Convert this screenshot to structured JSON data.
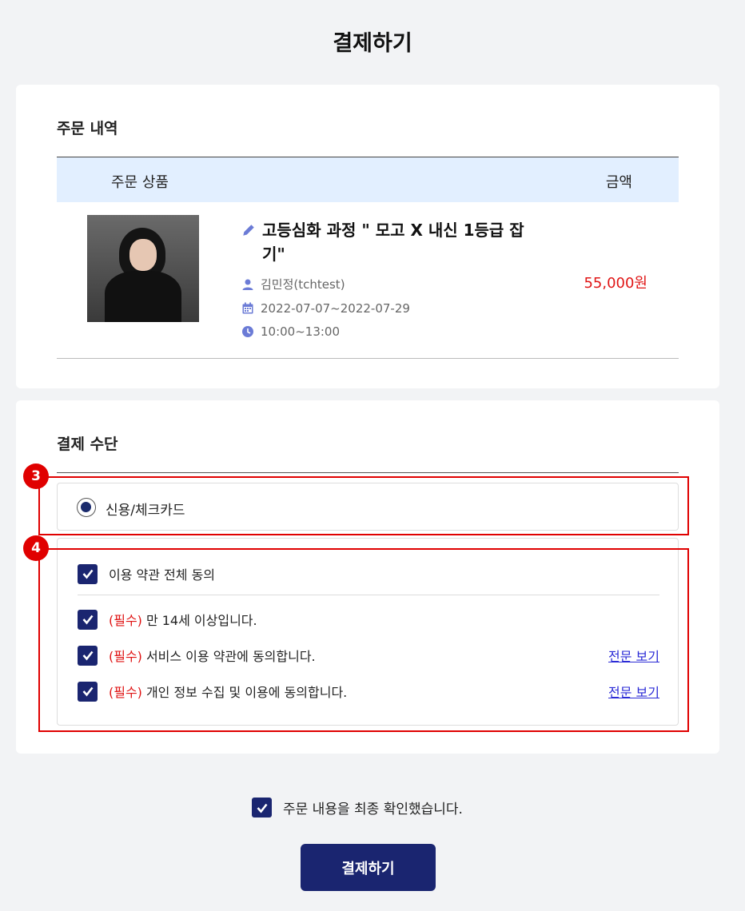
{
  "page": {
    "title": "결제하기"
  },
  "order": {
    "section_title": "주문 내역",
    "columns": {
      "product": "주문 상품",
      "price": "금액"
    },
    "item": {
      "name": "고등심화 과정 \" 모고 X 내신 1등급 잡기\"",
      "teacher": "김민정(tchtest)",
      "period": "2022-07-07~2022-07-29",
      "time": "10:00~13:00",
      "price": "55,000원"
    }
  },
  "payment": {
    "section_title": "결제 수단",
    "method": {
      "label": "신용/체크카드",
      "selected": true
    },
    "agreements": {
      "all": "이용 약관 전체 동의",
      "required_prefix": "(필수)",
      "items": [
        {
          "text": "만 14세 이상입니다.",
          "link": ""
        },
        {
          "text": "서비스 이용 약관에 동의합니다.",
          "link": "전문 보기"
        },
        {
          "text": "개인 정보 수집 및 이용에 동의합니다.",
          "link": "전문 보기"
        }
      ]
    }
  },
  "annotations": {
    "badge_3": "3",
    "badge_4": "4"
  },
  "final_confirm": "주문 내용을 최종 확인했습니다.",
  "submit_button": "결제하기",
  "colors": {
    "primary": "#1a2570",
    "price": "#e01616",
    "highlight": "#e00000",
    "table_header": "#e2efff",
    "icon": "#6b7bd6"
  }
}
